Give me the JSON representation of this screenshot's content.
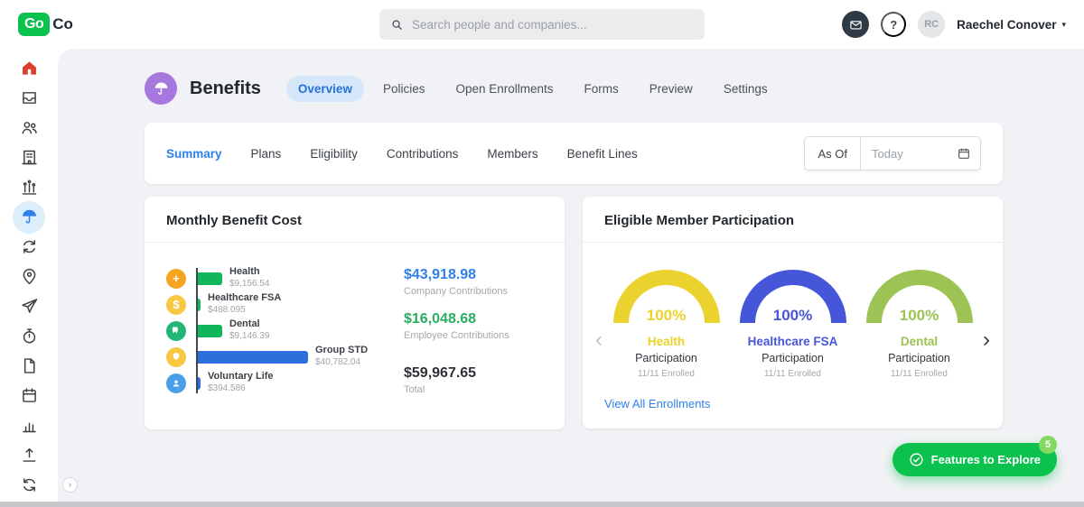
{
  "topbar": {
    "logo_primary": "Go",
    "logo_secondary": "Co",
    "search_placeholder": "Search people and companies...",
    "user_initials": "RC",
    "user_name": "Raechel Conover"
  },
  "sidebar": {
    "items": [
      {
        "name": "home",
        "icon": "home-icon",
        "active": false
      },
      {
        "name": "inbox",
        "icon": "inbox-icon",
        "active": false
      },
      {
        "name": "team",
        "icon": "team-icon",
        "active": false
      },
      {
        "name": "company",
        "icon": "building-icon",
        "active": false
      },
      {
        "name": "celebrations",
        "icon": "celebrations-icon",
        "active": false
      },
      {
        "name": "benefits",
        "icon": "umbrella-icon",
        "active": true
      },
      {
        "name": "payroll",
        "icon": "sync-icon",
        "active": false
      },
      {
        "name": "hiring",
        "icon": "person-pin-icon",
        "active": false
      },
      {
        "name": "time-off",
        "icon": "airplane-icon",
        "active": false
      },
      {
        "name": "time-tracking",
        "icon": "stopwatch-icon",
        "active": false
      },
      {
        "name": "documents",
        "icon": "document-icon",
        "active": false
      },
      {
        "name": "calendar",
        "icon": "calendar-icon",
        "active": false
      },
      {
        "name": "reports",
        "icon": "bar-chart-icon",
        "active": false
      },
      {
        "name": "exports",
        "icon": "upload-icon",
        "active": false
      },
      {
        "name": "integrations",
        "icon": "sync-icon",
        "active": false
      }
    ]
  },
  "page": {
    "title": "Benefits",
    "tabs": [
      {
        "label": "Overview",
        "active": true
      },
      {
        "label": "Policies",
        "active": false
      },
      {
        "label": "Open Enrollments",
        "active": false
      },
      {
        "label": "Forms",
        "active": false
      },
      {
        "label": "Preview",
        "active": false
      },
      {
        "label": "Settings",
        "active": false
      }
    ]
  },
  "subnav": {
    "tabs": [
      {
        "label": "Summary",
        "active": true
      },
      {
        "label": "Plans",
        "active": false
      },
      {
        "label": "Eligibility",
        "active": false
      },
      {
        "label": "Contributions",
        "active": false
      },
      {
        "label": "Members",
        "active": false
      },
      {
        "label": "Benefit Lines",
        "active": false
      }
    ],
    "as_of_label": "As Of",
    "as_of_value": "Today"
  },
  "monthly_cost": {
    "title": "Monthly Benefit Cost",
    "rows": [
      {
        "name": "Health",
        "value": "$9,156.54",
        "amount_num": 9156.54,
        "bar_color": "#10b659",
        "icon_color": "#f6a522",
        "icon": "health-icon",
        "glyph": "+"
      },
      {
        "name": "Healthcare FSA",
        "value": "$488.095",
        "amount_num": 488.095,
        "bar_color": "#10b659",
        "icon_color": "#f7c844",
        "icon": "fsa-icon",
        "glyph": "$"
      },
      {
        "name": "Dental",
        "value": "$9,146.39",
        "amount_num": 9146.39,
        "bar_color": "#10b659",
        "icon_color": "#23b573",
        "icon": "tooth-icon"
      },
      {
        "name": "Group STD",
        "value": "$40,782.04",
        "amount_num": 40782.04,
        "bar_color": "#2a6fdb",
        "icon_color": "#f7c844",
        "icon": "shield-icon"
      },
      {
        "name": "Voluntary Life",
        "value": "$394.586",
        "amount_num": 394.586,
        "bar_color": "#2a6fdb",
        "icon_color": "#4aa0e8",
        "icon": "person-icon"
      }
    ],
    "summary": [
      {
        "amount": "$43,918.98",
        "label": "Company Contributions",
        "color": "#2f80ed"
      },
      {
        "amount": "$16,048.68",
        "label": "Employee Contributions",
        "color": "#27ae60"
      },
      {
        "amount": "$59,967.65",
        "label": "Total",
        "color": "#2d3136"
      }
    ]
  },
  "participation": {
    "title": "Eligible Member Participation",
    "gauges": [
      {
        "percent": "100%",
        "name": "Health",
        "sublabel": "Participation",
        "enrolled": "11/11 Enrolled",
        "color": "#ecd22e"
      },
      {
        "percent": "100%",
        "name": "Healthcare FSA",
        "sublabel": "Participation",
        "enrolled": "11/11 Enrolled",
        "color": "#4656d8"
      },
      {
        "percent": "100%",
        "name": "Dental",
        "sublabel": "Participation",
        "enrolled": "11/11 Enrolled",
        "color": "#9cc353"
      }
    ],
    "link_label": "View All Enrollments"
  },
  "features_button": {
    "label": "Features to Explore",
    "badge": "5"
  },
  "colors": {
    "brand_green": "#0bc24f",
    "accent_blue": "#2f80ed",
    "content_bg": "#f1f2f5"
  }
}
